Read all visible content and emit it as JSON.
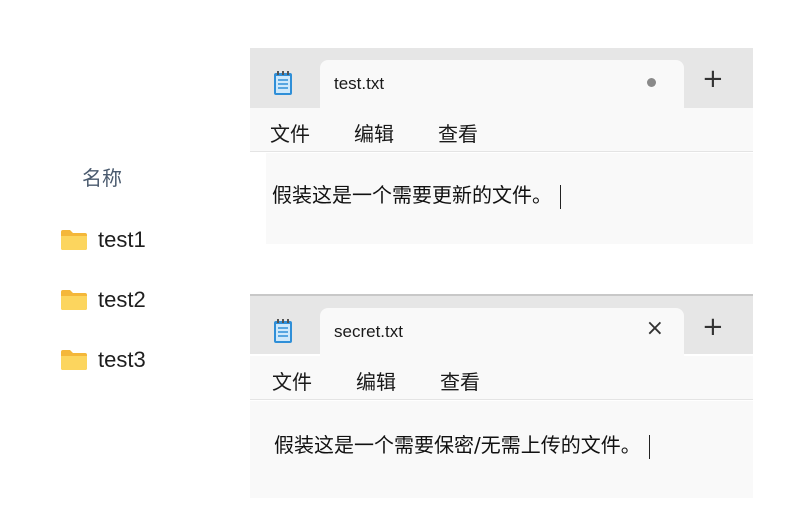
{
  "explorer": {
    "column_header": "名称",
    "folders": [
      {
        "name": "test1",
        "icon": "folder-icon"
      },
      {
        "name": "test2",
        "icon": "folder-icon"
      },
      {
        "name": "test3",
        "icon": "folder-icon"
      }
    ]
  },
  "windows": [
    {
      "tab_title": "test.txt",
      "tab_state": "unsaved-dot",
      "new_tab_label": "+",
      "menu": [
        "文件",
        "编辑",
        "查看"
      ],
      "content": "假装这是一个需要更新的文件。"
    },
    {
      "tab_title": "secret.txt",
      "tab_state": "close",
      "close_label": "×",
      "new_tab_label": "+",
      "menu": [
        "文件",
        "编辑",
        "查看"
      ],
      "content": "假装这是一个需要保密/无需上传的文件。"
    }
  ],
  "colors": {
    "tabbar_bg": "#e6e6e6",
    "tab_bg": "#f9f9f9",
    "folder_yellow": "#f7c948",
    "header_text": "#4a5a6e"
  }
}
